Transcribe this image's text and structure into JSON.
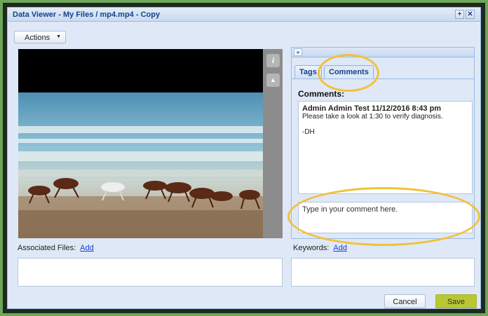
{
  "window": {
    "title": "Data Viewer - My Files / mp4.mp4 - Copy",
    "expand_glyph": "+",
    "close_glyph": "✕"
  },
  "toolbar": {
    "actions_label": "Actions",
    "actions_caret": "▼"
  },
  "side_tools": {
    "info_glyph": "i",
    "user_glyph": "▲"
  },
  "panel": {
    "collapse_glyph": "»",
    "tabs": [
      {
        "label": "Tags"
      },
      {
        "label": "Comments"
      }
    ],
    "comments_heading": "Comments:",
    "comment": {
      "author_line": "Admin Admin Test 11/12/2016 8:43 pm",
      "body": "Please take a look at 1:30 to verify diagnosis.",
      "signature": "-DH"
    },
    "input_placeholder": "Type in your comment here."
  },
  "associated_files": {
    "label": "Associated Files:",
    "add_link": "Add"
  },
  "keywords": {
    "label": "Keywords:",
    "add_link": "Add"
  },
  "footer": {
    "cancel_label": "Cancel",
    "save_label": "Save"
  },
  "colors": {
    "highlight": "#f0c23b",
    "save_button": "#b9c832",
    "frame_border": "#6fa75a"
  },
  "icons": [
    "info-icon",
    "user-add-icon",
    "collapse-icon",
    "expand-icon",
    "close-icon",
    "chevron-down-icon"
  ]
}
